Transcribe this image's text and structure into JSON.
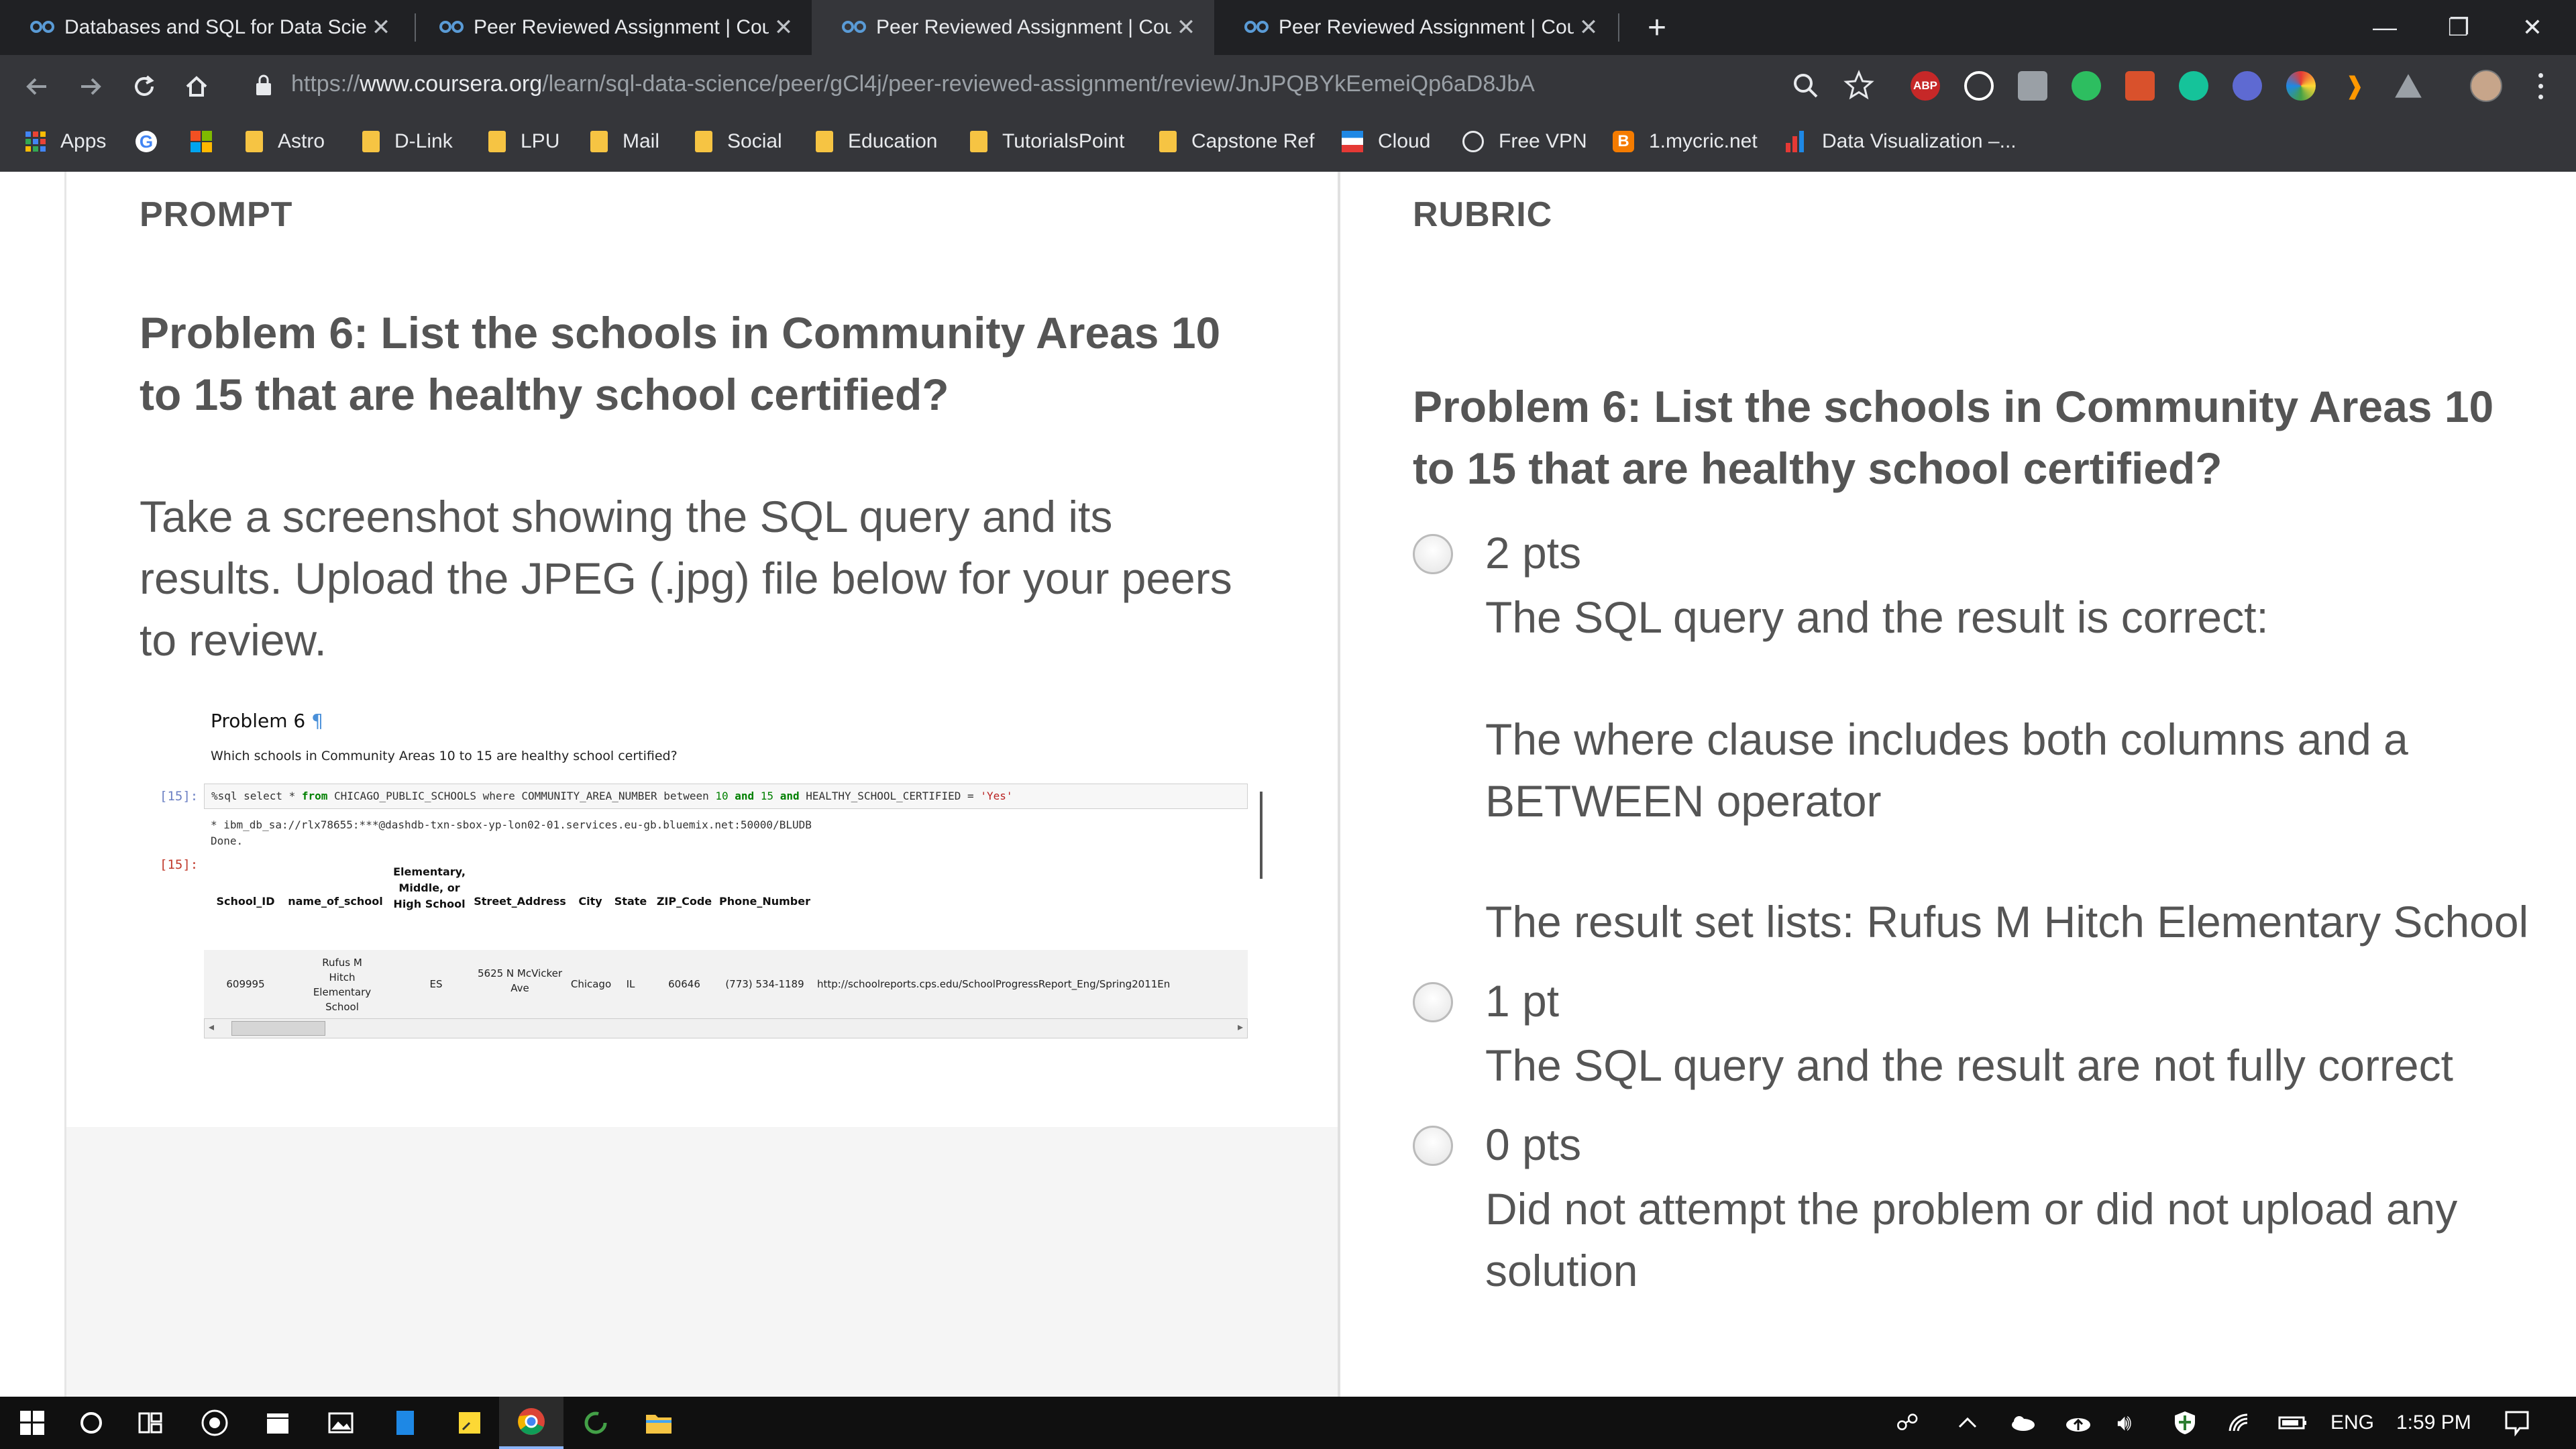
{
  "browser": {
    "tabs": [
      {
        "title": "Databases and SQL for Data Scie",
        "active": false
      },
      {
        "title": "Peer Reviewed Assignment | Cou",
        "active": false
      },
      {
        "title": "Peer Reviewed Assignment | Cou",
        "active": true
      },
      {
        "title": "Peer Reviewed Assignment | Cou",
        "active": false
      }
    ],
    "tab_close": "✕",
    "new_tab": "+",
    "window_controls": {
      "minimize": "—",
      "restore": "❐",
      "close": "✕"
    },
    "url": {
      "scheme": "https://",
      "host": "www.coursera.org",
      "path": "/learn/sql-data-science/peer/gCl4j/peer-reviewed-assignment/review/JnJPQBYkEemeiQp6aD8JbA"
    },
    "extensions": {
      "abp": "ABP"
    },
    "bookmarks": [
      "Apps",
      "Astro",
      "D-Link",
      "LPU",
      "Mail",
      "Social",
      "Education",
      "TutorialsPoint",
      "Capstone Ref",
      "Cloud",
      "Free VPN",
      "1.mycric.net",
      "Data Visualization –..."
    ]
  },
  "prompt": {
    "section_label": "PROMPT",
    "heading_lines": [
      "Problem 6: List the schools in Community Areas 10",
      "to 15 that are healthy school certified?"
    ],
    "instruction_lines": [
      "Take a screenshot showing the SQL query and its",
      "results. Upload the JPEG (.jpg) file below for your peers",
      "to review."
    ]
  },
  "notebook": {
    "title": "Problem 6",
    "pilcrow": "¶",
    "question": "Which schools in Community Areas 10 to 15 are healthy school certified?",
    "in_prompt": "[15]:",
    "out_prompt": "[15]:",
    "query": {
      "p1": "%sql select * ",
      "kw_from": "from",
      "p2": " CHICAGO_PUBLIC_SCHOOLS where COMMUNITY_AREA_NUMBER between ",
      "n1": "10",
      "kw_and1": " and ",
      "n2": "15",
      "kw_and2": " and ",
      "p3": "HEALTHY_SCHOOL_CERTIFIED = ",
      "str": "'Yes'"
    },
    "connection": " * ibm_db_sa://rlx78655:***@dashdb-txn-sbox-yp-lon02-01.services.eu-gb.bluemix.net:50000/BLUDB",
    "done": "Done.",
    "columns": [
      "School_ID",
      "name_of_school",
      "Elementary, Middle, or High School",
      "Street_Address",
      "City",
      "State",
      "ZIP_Code",
      "Phone_Number"
    ],
    "row": {
      "school_id": "609995",
      "name": "Rufus M Hitch Elementary School",
      "level": "ES",
      "address": "5625 N McVicker Ave",
      "city": "Chicago",
      "state": "IL",
      "zip": "60646",
      "phone": "(773) 534-1189",
      "link": "http://schoolreports.cps.edu/SchoolProgressReport_Eng/Spring2011En"
    }
  },
  "rubric": {
    "section_label": "RUBRIC",
    "heading_lines": [
      "Problem 6: List the schools in Community Areas 10",
      "to 15 that are healthy school certified?"
    ],
    "options": [
      {
        "points": "2 pts",
        "lines": [
          "The SQL query and the result is correct:",
          "",
          "The where clause includes both columns and a",
          "BETWEEN operator",
          "",
          "The result set lists: Rufus M Hitch Elementary School"
        ]
      },
      {
        "points": "1 pt",
        "lines": [
          "The SQL query and the result are not fully correct"
        ]
      },
      {
        "points": "0 pts",
        "lines": [
          "Did not attempt the problem or did not upload any",
          "solution"
        ]
      }
    ]
  },
  "taskbar": {
    "language": "ENG",
    "time": "1:59 PM"
  },
  "colors": {
    "tab_bg": "#202124",
    "toolbar_bg": "#35363a",
    "text_gray": "#555555",
    "taskbar_bg": "#101010"
  }
}
